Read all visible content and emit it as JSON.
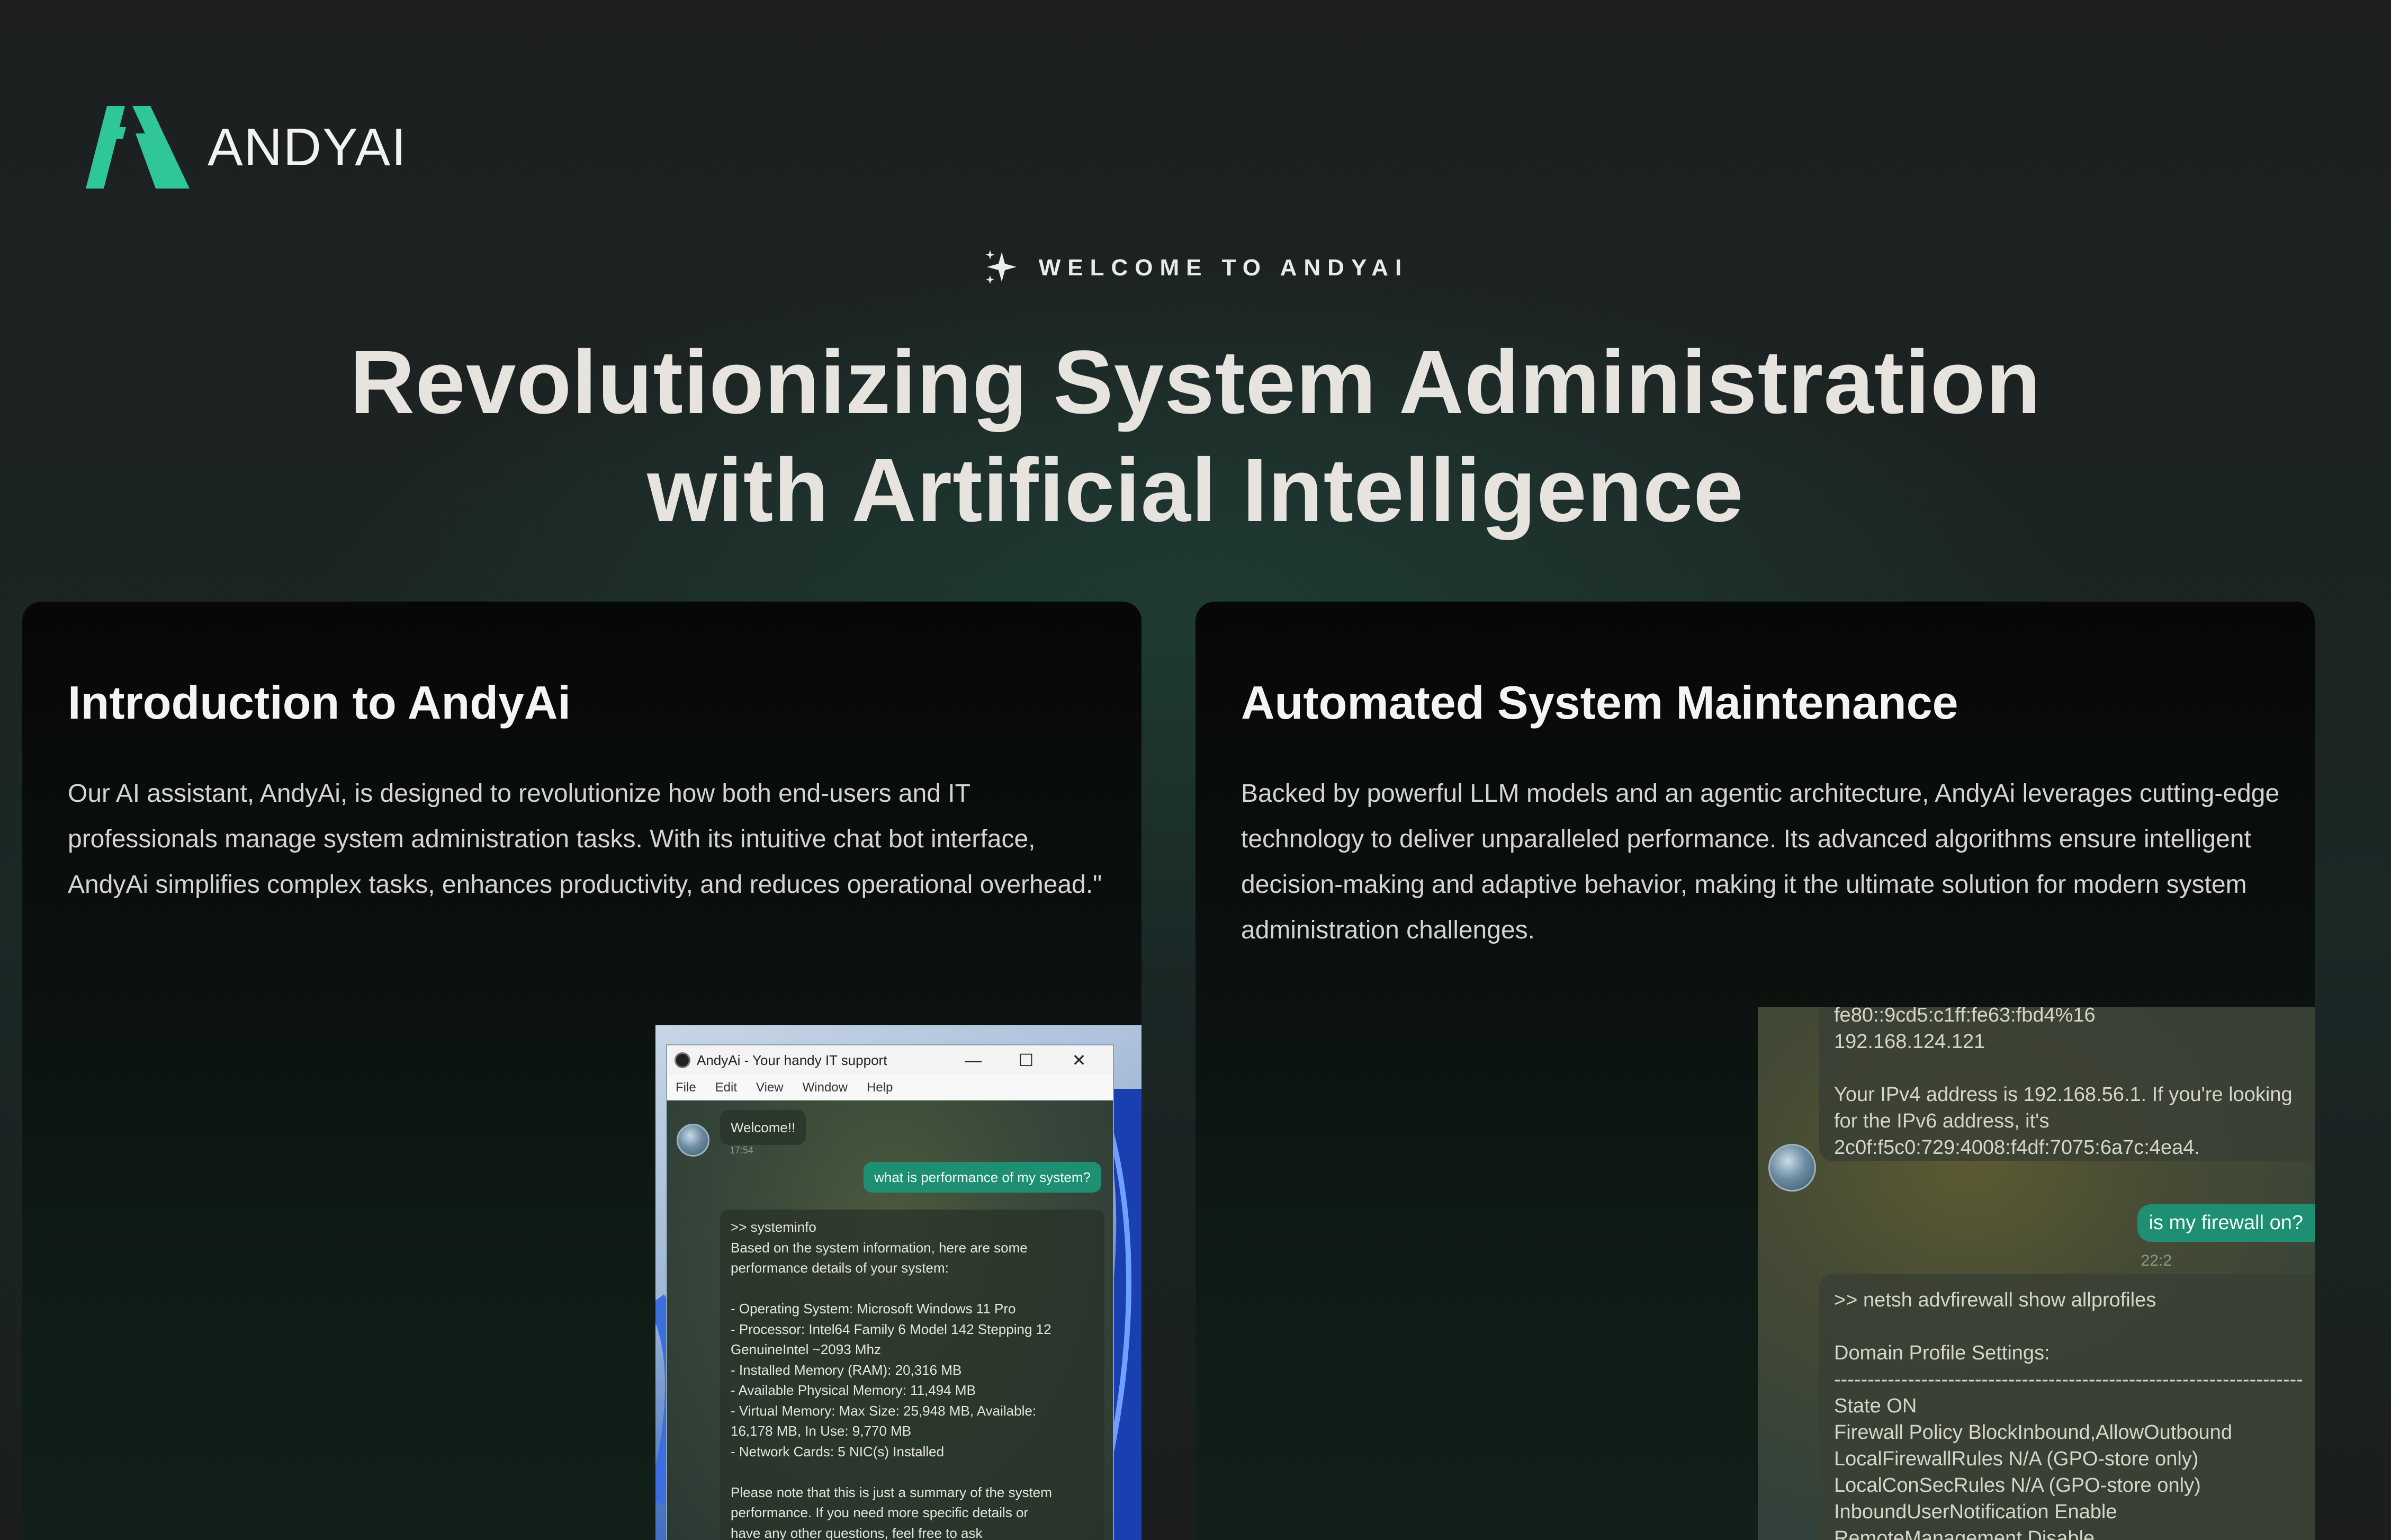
{
  "brand": {
    "name": "ANDYAI",
    "accent": "#2fc69a"
  },
  "hero": {
    "eyebrow": "WELCOME TO ANDYAI",
    "title_line1": "Revolutionizing System Administration",
    "title_line2": "with Artificial Intelligence"
  },
  "cards": [
    {
      "title": "Introduction to AndyAi",
      "body": "Our AI assistant, AndyAi, is designed to revolutionize how both end-users and IT professionals manage system administration tasks. With its intuitive chat bot interface, AndyAi simplifies complex tasks, enhances productivity, and reduces operational overhead.\""
    },
    {
      "title": "Automated System Maintenance",
      "body": "Backed by powerful LLM models and an agentic architecture, AndyAi leverages cutting-edge technology to deliver unparalleled performance. Its advanced algorithms ensure intelligent decision-making and adaptive behavior, making it the ultimate solution for modern system administration challenges."
    }
  ],
  "app_window": {
    "title": "AndyAi - Your handy IT support",
    "controls": {
      "minimize": "—",
      "maximize": "☐",
      "close": "✕"
    },
    "menu": [
      "File",
      "Edit",
      "View",
      "Window",
      "Help"
    ],
    "welcome": "Welcome!!",
    "welcome_time": "17:54",
    "user_msg": "what is performance of my system?",
    "reply_lines": [
      ">> systeminfo",
      "Based on the system information, here are some",
      "performance details of your system:",
      "",
      "- Operating System: Microsoft Windows 11 Pro",
      "- Processor: Intel64 Family 6 Model 142 Stepping 12",
      "GenuineIntel ~2093 Mhz",
      "- Installed Memory (RAM): 20,316 MB",
      "- Available Physical Memory: 11,494 MB",
      "- Virtual Memory: Max Size: 25,948 MB, Available:",
      "16,178 MB, In Use: 9,770 MB",
      "- Network Cards: 5 NIC(s) Installed",
      "",
      "Please note that this is just a summary of the system",
      "performance. If you need more specific details or",
      "have any other questions, feel free to ask"
    ]
  },
  "chat_right": {
    "prev_lines": [
      "fe80::9cd5:c1ff:fe63:fbd4%16",
      "192.168.124.121",
      "",
      "Your IPv4 address is 192.168.56.1. If you're looking",
      "for the IPv6 address, it's",
      "2c0f:f5c0:729:4008:f4df:7075:6a7c:4ea4."
    ],
    "user_msg": "is my firewall on?",
    "user_time": "22:2",
    "reply_lines": [
      ">> netsh advfirewall show allprofiles",
      "",
      "Domain Profile Settings:",
      "----------------------------------------------------------------------",
      "State ON",
      "Firewall Policy BlockInbound,AllowOutbound",
      "LocalFirewallRules N/A (GPO-store only)",
      "LocalConSecRules N/A (GPO-store only)",
      "InboundUserNotification Enable",
      "RemoteManagement Disable"
    ]
  }
}
